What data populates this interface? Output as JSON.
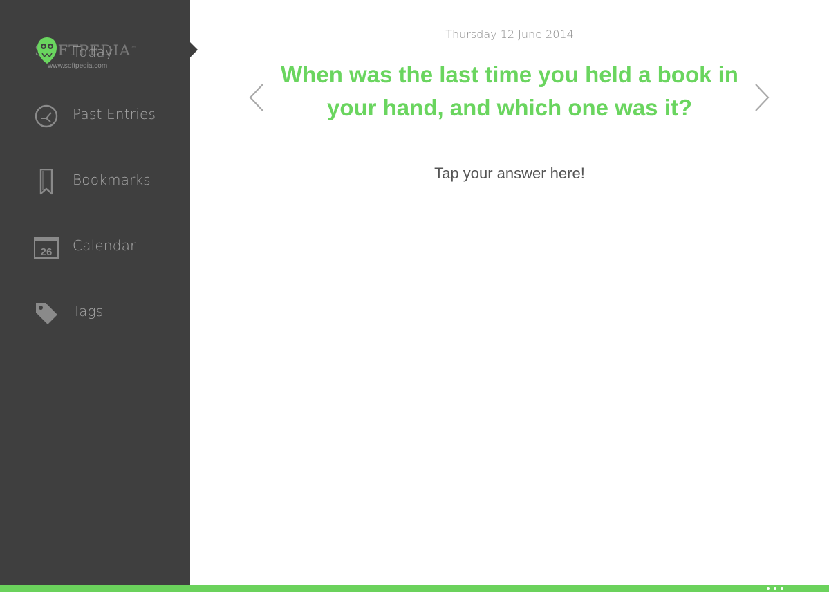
{
  "sidebar": {
    "items": [
      {
        "id": "today",
        "label": "Today",
        "icon": "owl-icon",
        "active": true
      },
      {
        "id": "past-entries",
        "label": "Past Entries",
        "icon": "clock-back-icon"
      },
      {
        "id": "bookmarks",
        "label": "Bookmarks",
        "icon": "bookmark-icon"
      },
      {
        "id": "calendar",
        "label": "Calendar",
        "icon": "calendar-icon",
        "icon_day": "26"
      },
      {
        "id": "tags",
        "label": "Tags",
        "icon": "tag-icon"
      }
    ]
  },
  "watermark": {
    "text": "SOFTPEDIA",
    "tm": "™",
    "url": "www.softpedia.com"
  },
  "main": {
    "date": "Thursday 12 June 2014",
    "question": "When was the last time you held a book in your hand, and which one was it?",
    "answer_placeholder": "Tap your answer here!",
    "prev_icon": "chevron-left-icon",
    "next_icon": "chevron-right-icon"
  },
  "app_bar": {
    "more_icon": "more-dots-icon"
  },
  "colors": {
    "accent": "#6ad55f",
    "sidebar_bg": "#3f3f3f",
    "nav_text": "#a6a6a6",
    "icon_gray": "#8a8a8a"
  }
}
